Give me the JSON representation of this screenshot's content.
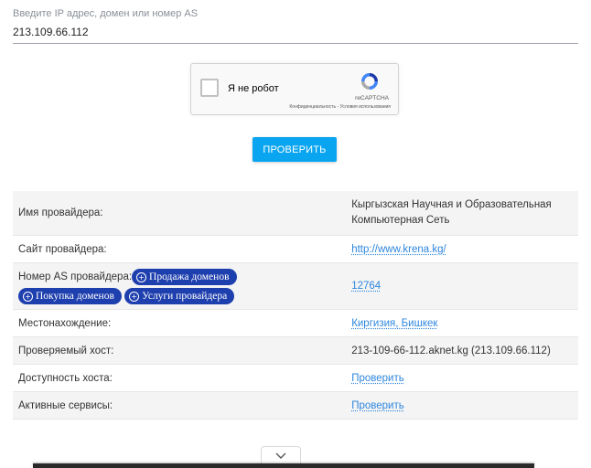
{
  "search": {
    "label": "Введите IP адрес, домен или номер AS",
    "value": "213.109.66.112"
  },
  "captcha": {
    "label": "Я не робот",
    "brand": "reCAPTCHA",
    "privacy": "Конфиденциальность",
    "separator": " - ",
    "terms": "Условия использования"
  },
  "check_button": {
    "label": "ПРОВЕРИТЬ"
  },
  "table": {
    "provider": {
      "label": "Имя провайдера:",
      "value_line1": "Кыргызская Научная и Образовательная",
      "value_line2": "Компьютерная Сеть"
    },
    "site": {
      "label": "Сайт провайдера:",
      "value": "http://www.krena.kg/"
    },
    "as": {
      "label": "Номер AS провайдера:",
      "value": "12764",
      "pills": [
        "Продажа доменов",
        "Покупка доменов",
        "Услуги провайдера"
      ]
    },
    "location": {
      "label": "Местонахождение:",
      "value": "Киргизия, Бишкек"
    },
    "host": {
      "label": "Проверяемый хост:",
      "value": "213-109-66-112.aknet.kg (213.109.66.112)"
    },
    "availability": {
      "label": "Доступность хоста:",
      "value": "Проверить"
    },
    "services": {
      "label": "Активные сервисы:",
      "value": "Проверить"
    }
  },
  "colors": {
    "accent": "#0aa5f0",
    "link": "#2e86de",
    "pill": "#1e3fae"
  }
}
